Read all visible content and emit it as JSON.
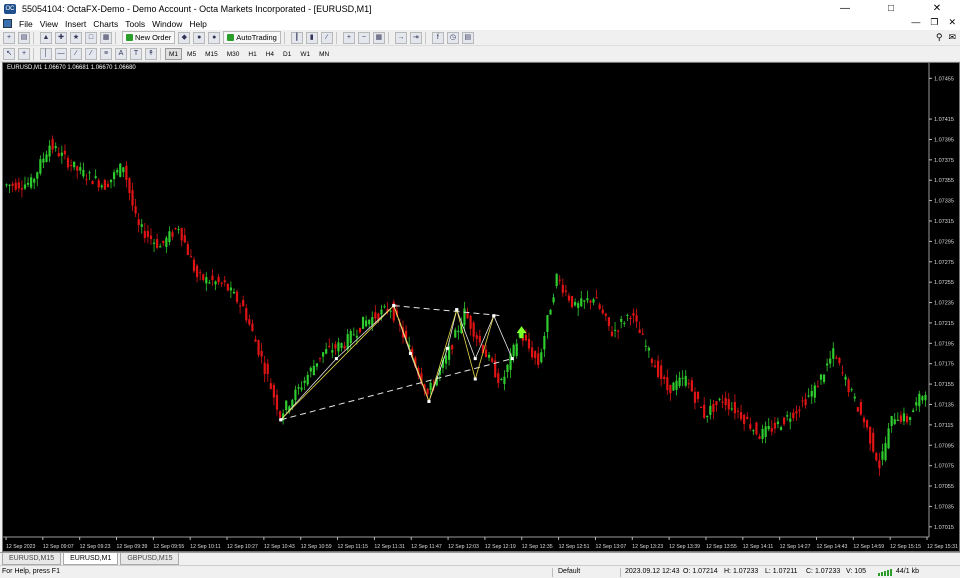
{
  "window": {
    "title": "55054104: OctaFX-Demo - Demo Account - Octa Markets Incorporated - [EURUSD,M1]",
    "app_icon_label": "OC"
  },
  "menu": [
    "File",
    "View",
    "Insert",
    "Charts",
    "Tools",
    "Window",
    "Help"
  ],
  "toolbar": {
    "new_order": "New Order",
    "autotrading": "AutoTrading",
    "timeframes": [
      "M1",
      "M5",
      "M15",
      "M30",
      "H1",
      "H4",
      "D1",
      "W1",
      "MN"
    ],
    "active_timeframe": "M1"
  },
  "chart": {
    "symbol_info": "EURUSD,M1  1.06670 1.06681 1.06670 1.06680",
    "bull_color": "#2ecc2e",
    "bear_color": "#e01414"
  },
  "chart_data": {
    "type": "candlestick",
    "symbol": "EURUSD",
    "timeframe": "M1",
    "y_ticks": [
      "1.07455",
      "1.07415",
      "1.07395",
      "1.07375",
      "1.07355",
      "1.07335",
      "1.07315",
      "1.07295",
      "1.07275",
      "1.07255",
      "1.07235",
      "1.07215",
      "1.07195",
      "1.07175",
      "1.07155",
      "1.07135",
      "1.07115",
      "1.07095",
      "1.07075",
      "1.07055",
      "1.07035",
      "1.07015"
    ],
    "ylim": [
      1.07015,
      1.07455
    ],
    "x_ticks": [
      "12 Sep 2023",
      "12 Sep 09:07",
      "12 Sep 09:23",
      "12 Sep 09:39",
      "12 Sep 09:55",
      "12 Sep 10:11",
      "12 Sep 10:27",
      "12 Sep 10:43",
      "12 Sep 10:59",
      "12 Sep 11:15",
      "12 Sep 11:31",
      "12 Sep 11:47",
      "12 Sep 12:03",
      "12 Sep 12:19",
      "12 Sep 12:35",
      "12 Sep 12:51",
      "12 Sep 13:07",
      "12 Sep 13:23",
      "12 Sep 13:39",
      "12 Sep 13:55",
      "12 Sep 14:11",
      "12 Sep 14:27",
      "12 Sep 14:43",
      "12 Sep 14:59",
      "12 Sep 15:15",
      "12 Sep 15:31"
    ],
    "price_path": [
      [
        0,
        1.0735
      ],
      [
        0.03,
        1.07352
      ],
      [
        0.05,
        1.0739
      ],
      [
        0.08,
        1.07365
      ],
      [
        0.11,
        1.0735
      ],
      [
        0.13,
        1.0737
      ],
      [
        0.145,
        1.0731
      ],
      [
        0.17,
        1.0729
      ],
      [
        0.19,
        1.0731
      ],
      [
        0.21,
        1.0726
      ],
      [
        0.24,
        1.07252
      ],
      [
        0.26,
        1.0723
      ],
      [
        0.28,
        1.0718
      ],
      [
        0.3,
        1.07125
      ],
      [
        0.32,
        1.0715
      ],
      [
        0.345,
        1.07185
      ],
      [
        0.37,
        1.07195
      ],
      [
        0.39,
        1.07215
      ],
      [
        0.42,
        1.0723
      ],
      [
        0.44,
        1.0719
      ],
      [
        0.46,
        1.07145
      ],
      [
        0.48,
        1.0718
      ],
      [
        0.5,
        1.07225
      ],
      [
        0.52,
        1.0719
      ],
      [
        0.54,
        1.07155
      ],
      [
        0.56,
        1.07205
      ],
      [
        0.58,
        1.07175
      ],
      [
        0.6,
        1.0726
      ],
      [
        0.62,
        1.0723
      ],
      [
        0.64,
        1.0724
      ],
      [
        0.66,
        1.07205
      ],
      [
        0.68,
        1.07225
      ],
      [
        0.7,
        1.07185
      ],
      [
        0.72,
        1.0715
      ],
      [
        0.74,
        1.0716
      ],
      [
        0.76,
        1.07125
      ],
      [
        0.78,
        1.0714
      ],
      [
        0.8,
        1.07125
      ],
      [
        0.82,
        1.07105
      ],
      [
        0.84,
        1.07115
      ],
      [
        0.86,
        1.0713
      ],
      [
        0.88,
        1.0715
      ],
      [
        0.9,
        1.07185
      ],
      [
        0.92,
        1.07145
      ],
      [
        0.935,
        1.07115
      ],
      [
        0.95,
        1.07075
      ],
      [
        0.965,
        1.07125
      ],
      [
        0.98,
        1.0712
      ],
      [
        1.0,
        1.0715
      ]
    ],
    "pattern_lines": {
      "upper_dashed": [
        [
          0.422,
          1.07232
        ],
        [
          0.54,
          1.07222
        ]
      ],
      "lower_dashed": [
        [
          0.3,
          1.0712
        ],
        [
          0.55,
          1.0718
        ]
      ],
      "zigzag": [
        [
          0.3,
          1.0712
        ],
        [
          0.36,
          1.0718
        ],
        [
          0.422,
          1.07232
        ],
        [
          0.44,
          1.07185
        ],
        [
          0.46,
          1.07138
        ],
        [
          0.48,
          1.0719
        ],
        [
          0.49,
          1.07228
        ],
        [
          0.51,
          1.0718
        ],
        [
          0.53,
          1.07222
        ],
        [
          0.55,
          1.0718
        ]
      ],
      "legs": [
        [
          0.3,
          1.0712
        ],
        [
          0.422,
          1.07232
        ],
        [
          0.46,
          1.07138
        ],
        [
          0.49,
          1.07228
        ],
        [
          0.51,
          1.0716
        ],
        [
          0.53,
          1.07222
        ]
      ],
      "line_color": "#e6e6e6",
      "leg_color": "#e8d84a",
      "signal_color": "#7dff2a"
    }
  },
  "tabs": [
    "EURUSD,M15",
    "EURUSD,M1",
    "GBPUSD,M15"
  ],
  "active_tab": "EURUSD,M1",
  "status": {
    "help": "For Help, press F1",
    "profile": "Default",
    "datetime": "2023.09.12 12:43",
    "open": "O: 1.07214",
    "high": "H: 1.07233",
    "low": "L: 1.07211",
    "close": "C: 1.07233",
    "volume": "V: 105",
    "traffic": "44/1 kb"
  }
}
